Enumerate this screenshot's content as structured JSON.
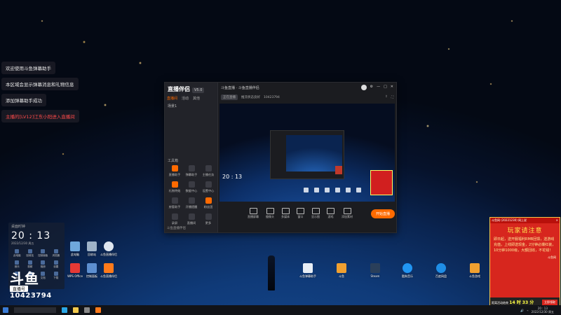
{
  "chat": [
    {
      "text": "欢迎使用斗鱼弹幕助手",
      "red": false
    },
    {
      "text": "本区域会显示弹幕消息和礼物信息",
      "red": false
    },
    {
      "text": "添加弹幕助手成功",
      "red": false
    },
    {
      "text": "主播的[LV12]江东小阳进入直播间",
      "red": true
    }
  ],
  "app": {
    "logo": "直播伴侣",
    "badge": "V5.0",
    "tabs": [
      "直播间",
      "活动",
      "其他"
    ],
    "scene": "场景1",
    "top_title": "斗鱼直播 · 斗鱼直播伴侣",
    "sub_live": "正在直播",
    "sub_items": [
      "推流状态良好",
      "10423794"
    ],
    "tools_title": "工具箱",
    "tools": [
      "直播助手",
      "弹幕助手",
      "主播任务",
      "礼物特效",
      "数据中心",
      "设置中心",
      "房管助手",
      "开播提醒",
      "粉丝团",
      "录屏",
      "直播间",
      "更多"
    ],
    "footer": "斗鱼直播伴侣",
    "controls": [
      "直播屏幕",
      "摄像头",
      "多媒体",
      "窗口",
      "显示图",
      "游戏",
      "添加素材"
    ],
    "start": "开始直播"
  },
  "clock": {
    "header": "桌面时钟",
    "time": "20 : 13",
    "date": "2022/12/30 周五",
    "apps": [
      "此电脑",
      "回收站",
      "控制面板",
      "浏览器",
      "音乐",
      "视频",
      "相册",
      "设置",
      "小程序",
      "工具",
      "文档",
      "下载"
    ]
  },
  "douyu": {
    "brand": "斗鱼",
    "sub": "直播号",
    "room": "10423794"
  },
  "desktop": [
    {
      "label": "此电脑",
      "color": "#6fa8dc"
    },
    {
      "label": "回收站",
      "color": "#9fb3c8"
    },
    {
      "label": "斗鱼直播伴侣",
      "color": "#dfe6ef"
    },
    {
      "label": "WPS Office",
      "color": "#e53935"
    },
    {
      "label": "控制面板",
      "color": "#5d8fd0"
    },
    {
      "label": "斗鱼直播伴侣",
      "color": "#ff7a1a"
    },
    {
      "label": "斗鱼弹幕助手",
      "color": "#e8eef5"
    },
    {
      "label": "斗鱼",
      "color": "#f0a030"
    },
    {
      "label": "Steam",
      "color": "#2a3f5a"
    },
    {
      "label": "酷狗音乐",
      "color": "#2196f3"
    },
    {
      "label": "百度网盘",
      "color": "#1f8ee6"
    },
    {
      "label": "斗鱼游戏",
      "color": "#f0a030"
    }
  ],
  "ad": {
    "title": "斗鱼网 (20221230) 网上说",
    "headline": "玩家请注意",
    "body": "即日起，送开服福利RMB回馈，送游戏充值，上线即送现金，2分钟必爆红装，10分钟1000级，大额回收，不花钱！",
    "sig": "斗鱼网",
    "footer_label": "距离活动结束",
    "timer": "14 时 33 分",
    "button": "立即领取"
  }
}
